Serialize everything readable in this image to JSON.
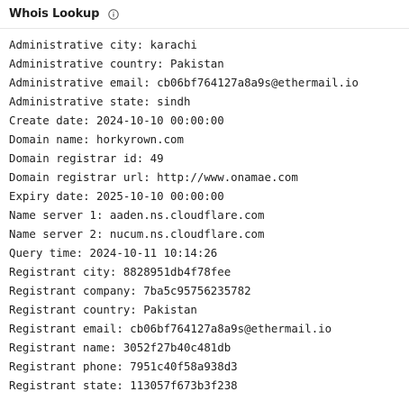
{
  "panel": {
    "title": "Whois Lookup",
    "info_icon": "info-circle-icon"
  },
  "records": [
    {
      "label": "Administrative city",
      "value": "karachi"
    },
    {
      "label": "Administrative country",
      "value": "Pakistan"
    },
    {
      "label": "Administrative email",
      "value": "cb06bf764127a8a9s@ethermail.io"
    },
    {
      "label": "Administrative state",
      "value": "sindh"
    },
    {
      "label": "Create date",
      "value": "2024-10-10 00:00:00"
    },
    {
      "label": "Domain name",
      "value": "horkyrown.com"
    },
    {
      "label": "Domain registrar id",
      "value": "49"
    },
    {
      "label": "Domain registrar url",
      "value": "http://www.onamae.com"
    },
    {
      "label": "Expiry date",
      "value": "2025-10-10 00:00:00"
    },
    {
      "label": "Name server 1",
      "value": "aaden.ns.cloudflare.com"
    },
    {
      "label": "Name server 2",
      "value": "nucum.ns.cloudflare.com"
    },
    {
      "label": "Query time",
      "value": "2024-10-11 10:14:26"
    },
    {
      "label": "Registrant city",
      "value": "8828951db4f78fee"
    },
    {
      "label": "Registrant company",
      "value": "7ba5c95756235782"
    },
    {
      "label": "Registrant country",
      "value": "Pakistan"
    },
    {
      "label": "Registrant email",
      "value": "cb06bf764127a8a9s@ethermail.io"
    },
    {
      "label": "Registrant name",
      "value": "3052f27b40c481db"
    },
    {
      "label": "Registrant phone",
      "value": "7951c40f58a938d3"
    },
    {
      "label": "Registrant state",
      "value": "113057f673b3f238"
    }
  ]
}
